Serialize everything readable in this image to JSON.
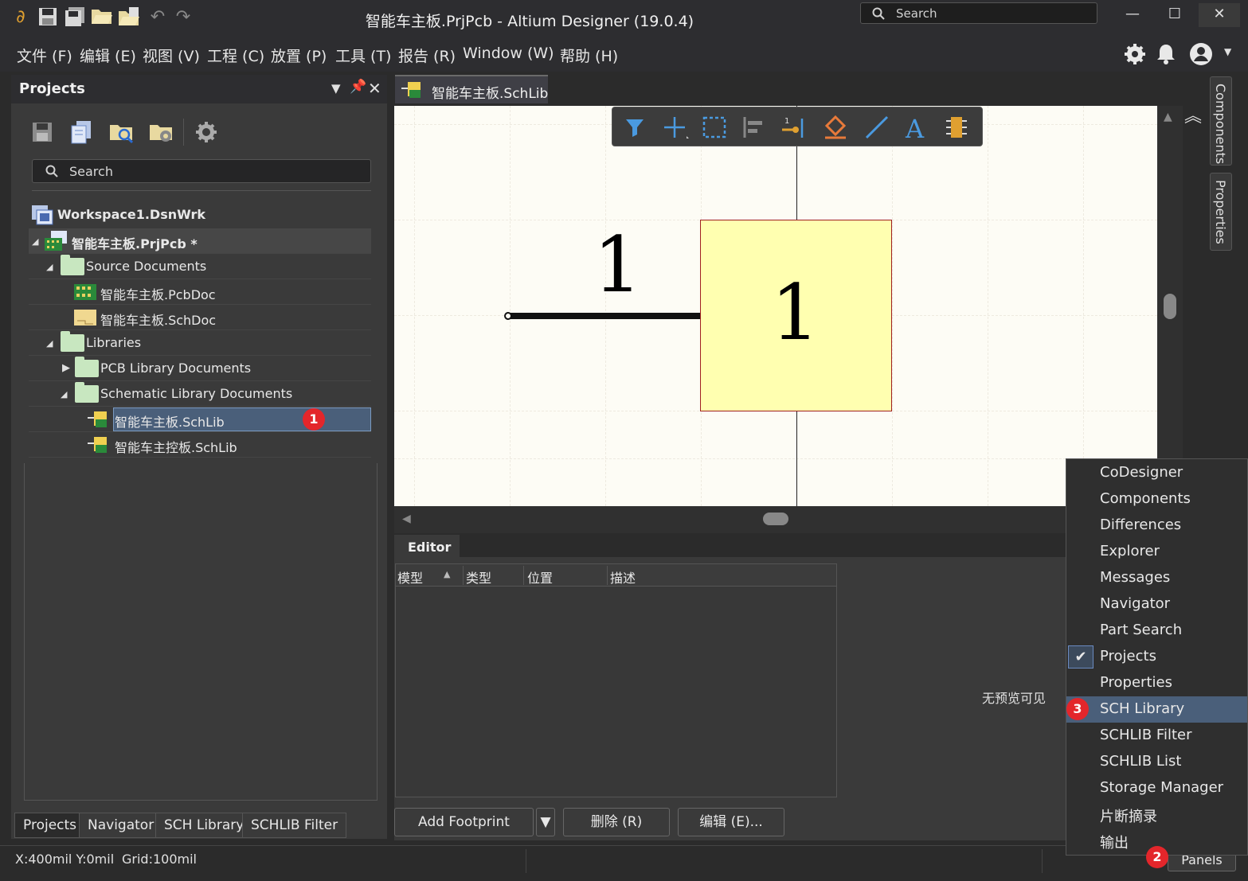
{
  "window": {
    "title": "智能车主板.PrjPcb - Altium Designer (19.0.4)",
    "search_placeholder": "Search",
    "minimize": "—",
    "maximize": "☐",
    "close": "✕"
  },
  "menu": [
    "文件 (F)",
    "编辑 (E)",
    "视图 (V)",
    "工程 (C)",
    "放置 (P)",
    "工具 (T)",
    "报告 (R)",
    "Window (W)",
    "帮助 (H)"
  ],
  "projects_panel": {
    "title": "Projects",
    "search_placeholder": "Search",
    "tree": {
      "workspace": "Workspace1.DsnWrk",
      "project": "智能车主板.PrjPcb *",
      "source_documents": "Source Documents",
      "pcb_doc": "智能车主板.PcbDoc",
      "sch_doc": "智能车主板.SchDoc",
      "libraries": "Libraries",
      "pcb_library_documents": "PCB Library Documents",
      "schematic_library_documents": "Schematic Library Documents",
      "schlib_1": "智能车主板.SchLib",
      "schlib_2": "智能车主控板.SchLib"
    },
    "bottom_tabs": [
      "Projects",
      "Navigator",
      "SCH Library",
      "SCHLIB Filter"
    ]
  },
  "document_tab": "智能车主板.SchLib",
  "canvas": {
    "pin_number": "1",
    "body_text": "1"
  },
  "editor": {
    "tab": "Editor",
    "columns": [
      "模型",
      "类型",
      "位置",
      "描述"
    ],
    "no_preview": "无预览可见",
    "add_footprint": "Add Footprint",
    "delete": "删除 (R)",
    "edit": "编辑 (E)..."
  },
  "right_tabs": [
    "Components",
    "Properties"
  ],
  "status": {
    "coords": "X:400mil Y:0mil",
    "grid": "Grid:100mil",
    "panels_button": "Panels"
  },
  "panels_menu": {
    "items": [
      "CoDesigner",
      "Components",
      "Differences",
      "Explorer",
      "Messages",
      "Navigator",
      "Part Search",
      "Projects",
      "Properties",
      "SCH Library",
      "SCHLIB Filter",
      "SCHLIB List",
      "Storage Manager",
      "片断摘录",
      "输出"
    ],
    "checked": "Projects",
    "highlighted": "SCH Library"
  },
  "badges": [
    "1",
    "2",
    "3"
  ],
  "colors": {
    "highlight": "#4a5f7a",
    "badge": "#e3262b",
    "component_body": "#ffffb0",
    "canvas": "#fdfcf5"
  }
}
